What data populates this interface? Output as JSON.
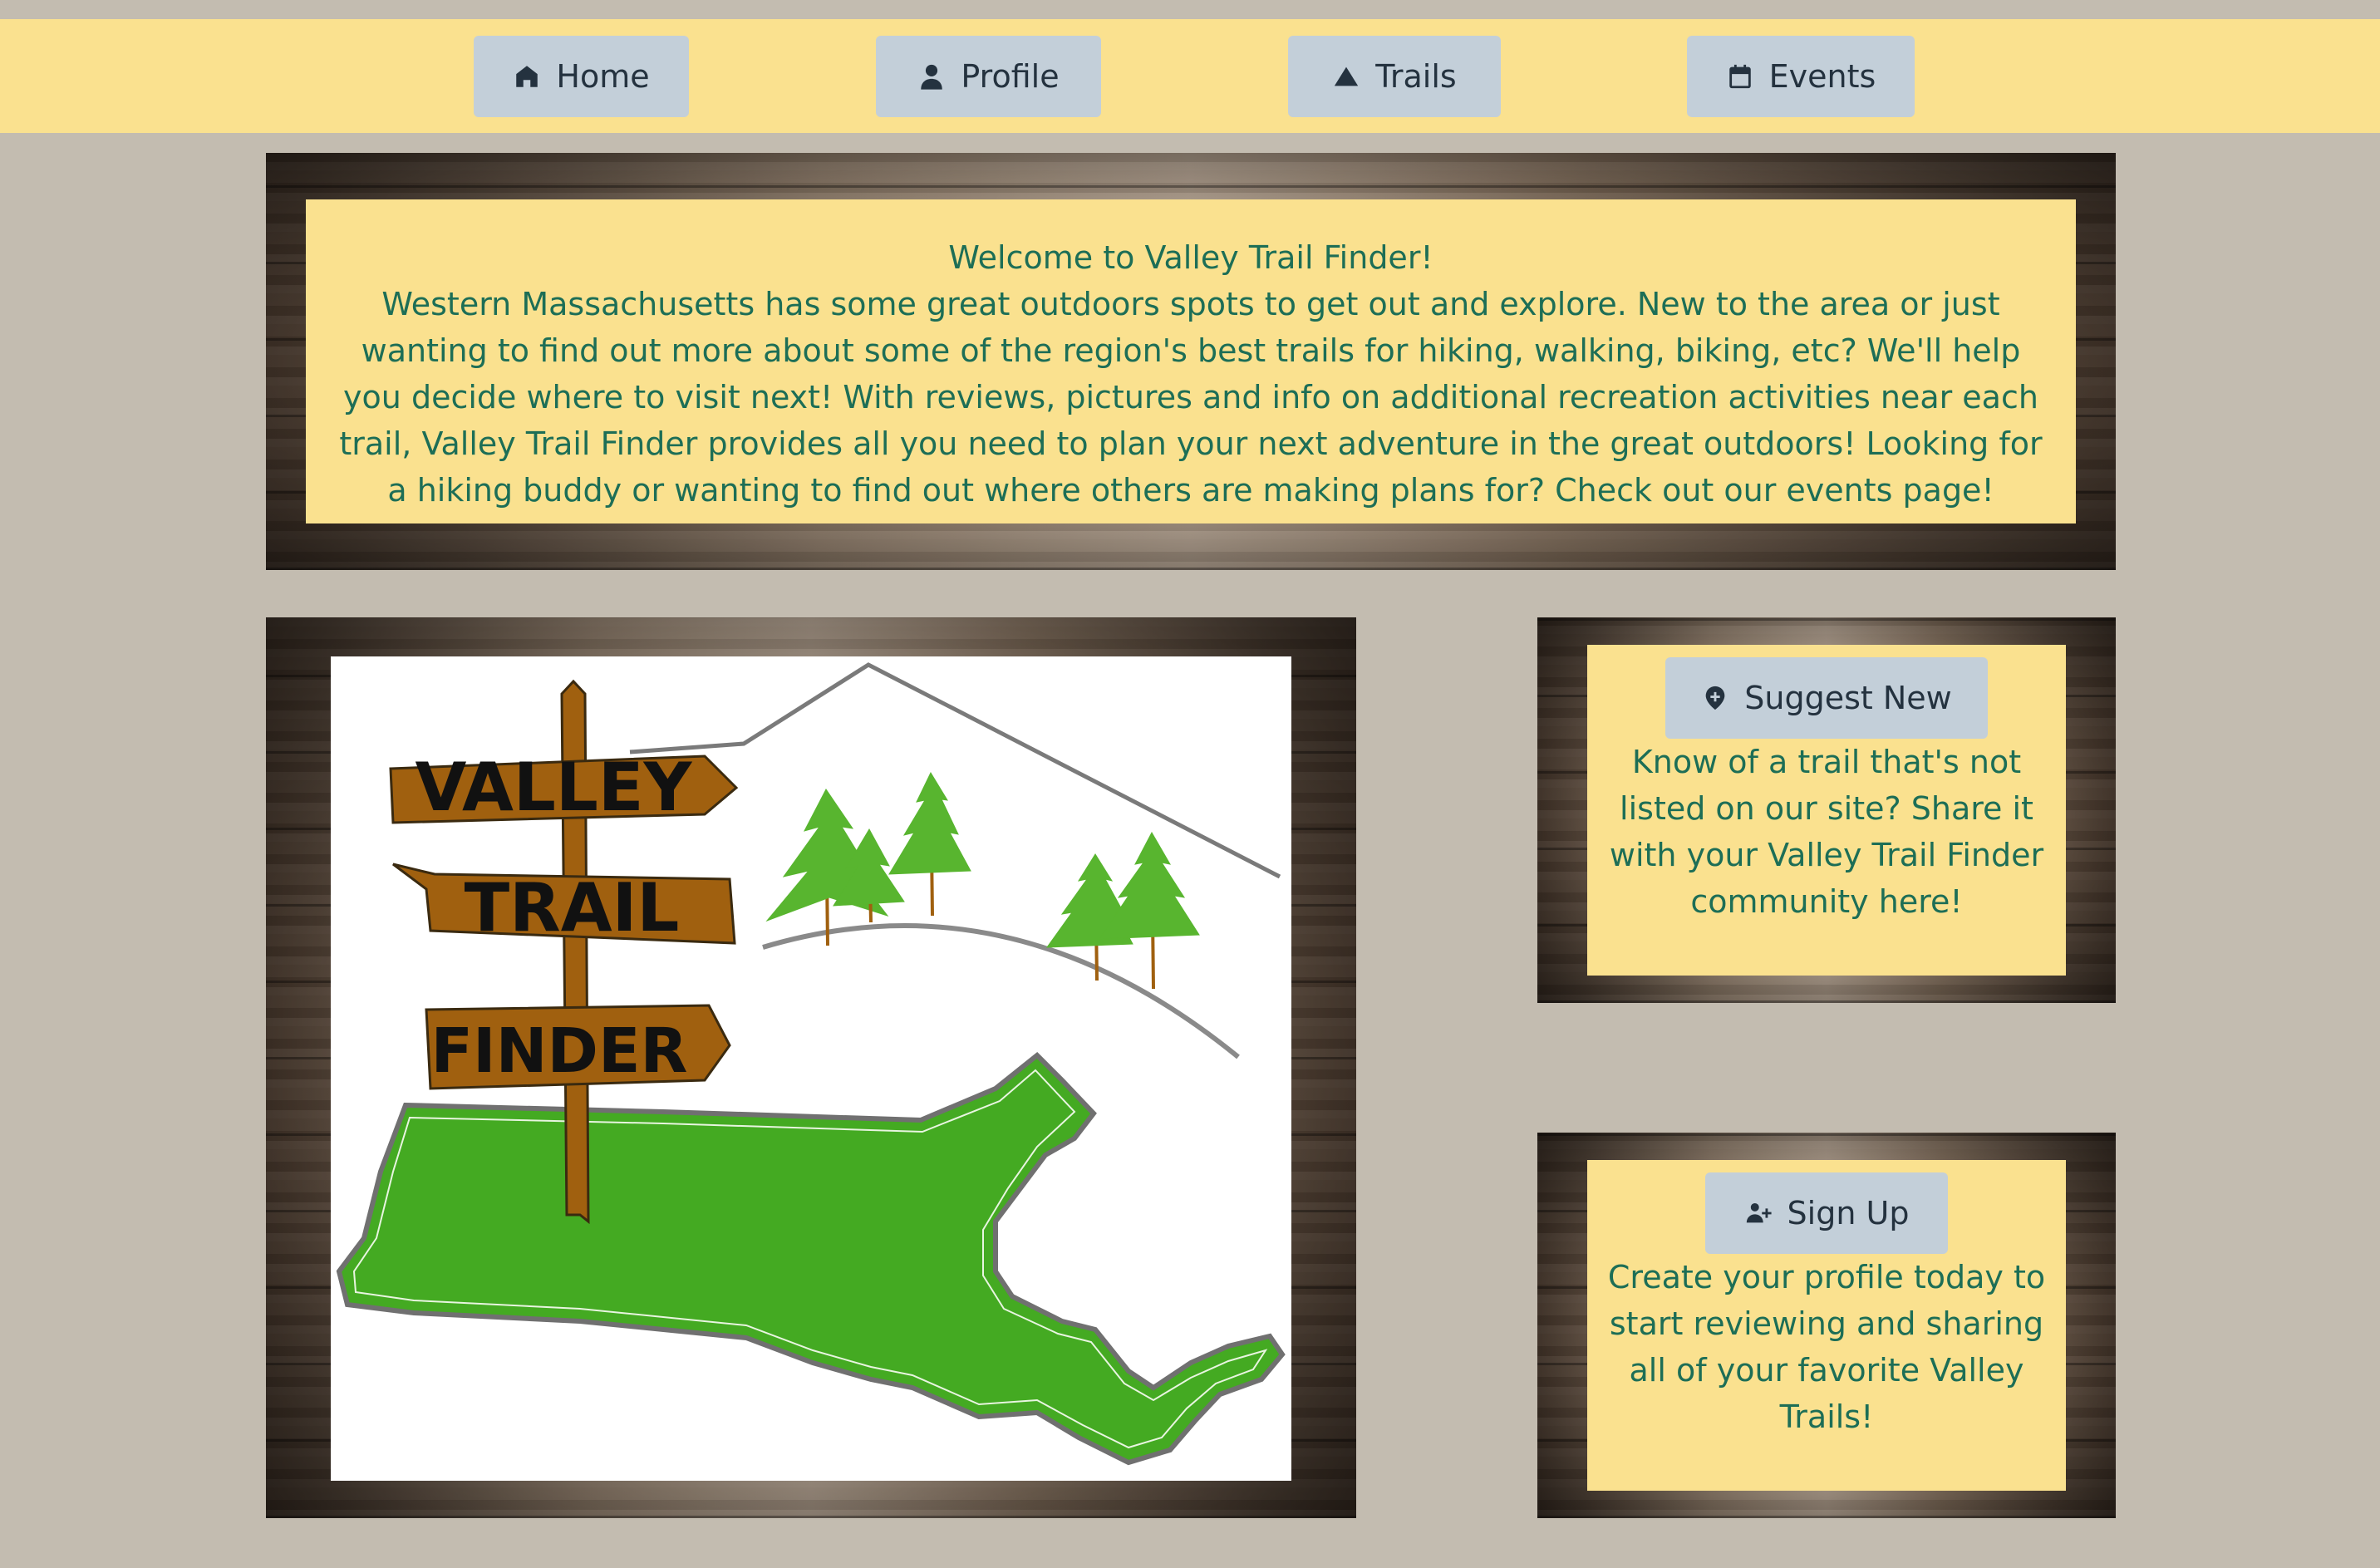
{
  "nav": {
    "items": [
      {
        "label": "Home",
        "icon": "home-icon"
      },
      {
        "label": "Profile",
        "icon": "person-icon"
      },
      {
        "label": "Trails",
        "icon": "mountain-icon"
      },
      {
        "label": "Events",
        "icon": "calendar-icon"
      }
    ]
  },
  "welcome": {
    "title": "Welcome to Valley Trail Finder!",
    "body": "Western Massachusetts has some great outdoors spots to get out and explore. New to the area or just wanting to find out more about some of the region's best trails for hiking, walking, biking, etc? We'll help you decide where to visit next! With reviews, pictures and info on additional recreation activities near each trail, Valley Trail Finder provides all you need to plan your next adventure in the great outdoors! Looking for a hiking buddy or wanting to find out where others are making plans for? Check out our events page!"
  },
  "logo": {
    "sign_words": [
      "VALLEY",
      "TRAIL",
      "FINDER"
    ]
  },
  "suggest": {
    "button_label": "Suggest New",
    "icon": "location-plus-icon",
    "text": "Know of a trail that's not listed on our site? Share it with your Valley Trail Finder community here!"
  },
  "signup": {
    "button_label": "Sign Up",
    "icon": "add-users-icon",
    "text": "Create your profile today to start reviewing and sharing all of your favorite Valley Trails!"
  },
  "colors": {
    "background": "#c3bcb0",
    "nav_bar": "#fae18f",
    "button": "#c3cfd9",
    "text_green": "#1d6e56",
    "state_green": "#44aa22",
    "sign_brown": "#a0600f"
  }
}
